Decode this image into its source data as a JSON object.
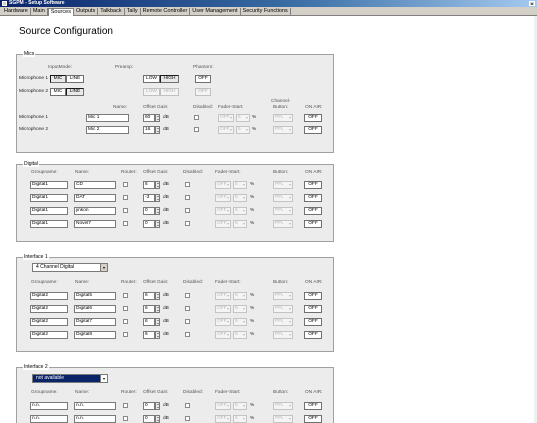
{
  "window": {
    "title": "SGPM - Setup Software",
    "close_glyph": "x"
  },
  "menu": [
    "Hardware",
    "Main",
    "Sources",
    "Outputs",
    "Talkback",
    "Tally",
    "Remote Controller",
    "User Management",
    "Security Functions"
  ],
  "active_menu": "Sources",
  "page_title": "Source Configuration",
  "common": {
    "db": "dB",
    "pct": "%",
    "off": "OFF"
  },
  "mics": {
    "label": "Mics",
    "h_inputmode": "InputMode:",
    "h_preamp": "Preamp:",
    "h_phantom": "Phantom:",
    "h_name": "Name:",
    "h_offset": "Offset Gain:",
    "h_disabled": "Disabled:",
    "h_fader": "Fader-Start:",
    "h_channel": "Channel-",
    "h_button": "Button:",
    "h_onair": "ON AIR:",
    "mode_mic": "MIC",
    "mode_line": "LINE",
    "pre_low": "LOW",
    "pre_high": "HIGH",
    "rows": [
      {
        "label": "Microphone 1",
        "name": "Mic 1",
        "gain": "60"
      },
      {
        "label": "Microphone 2",
        "name": "Mic 2",
        "gain": "16"
      }
    ]
  },
  "digital": {
    "label": "Digital",
    "h_group": "Groupname:",
    "h_name": "Name:",
    "h_router": "Router:",
    "h_offset": "Offset Gain:",
    "h_disabled": "Disabled:",
    "h_fader": "Fader-Start:",
    "h_button": "Button:",
    "h_onair": "ON AIR:",
    "rows": [
      {
        "group": "Digital1",
        "name": "CD",
        "gain": "6"
      },
      {
        "group": "Digital1",
        "name": "DAT",
        "gain": "-3"
      },
      {
        "group": "Digital1",
        "name": "jinkon",
        "gain": "0"
      },
      {
        "group": "Digital1",
        "name": "Novel7",
        "gain": "0"
      }
    ]
  },
  "interface1": {
    "label": "Interface 1",
    "select": "4 Channel Digital",
    "h_group": "Groupname:",
    "h_name": "Name:",
    "h_router": "Router:",
    "h_offset": "Offset Gain:",
    "h_disabled": "Disabled:",
    "h_fader": "Fader-Start:",
    "h_button": "Button:",
    "h_onair": "ON AIR:",
    "rows": [
      {
        "group": "Digital2",
        "name": "Digital5",
        "gain": "6"
      },
      {
        "group": "Digital2",
        "name": "Digital6",
        "gain": "6"
      },
      {
        "group": "Digital2",
        "name": "Digital7",
        "gain": "6"
      },
      {
        "group": "Digital2",
        "name": "Digital8",
        "gain": "6"
      }
    ]
  },
  "interface2": {
    "label": "Interface 2",
    "select": "not available",
    "h_group": "Groupname:",
    "h_name": "Name:",
    "h_router": "Router:",
    "h_offset": "Offset Gain:",
    "h_disabled": "Disabled:",
    "h_fader": "Fader-Start:",
    "h_button": "Button:",
    "h_onair": "ON AIR:",
    "rows": [
      {
        "group": "n.n.",
        "name": "n.n.",
        "gain": "0"
      },
      {
        "group": "n.n.",
        "name": "n.n.",
        "gain": "0"
      }
    ]
  },
  "fader_off": "OFF",
  "fader_val": "5",
  "button_pfl": "PFL"
}
